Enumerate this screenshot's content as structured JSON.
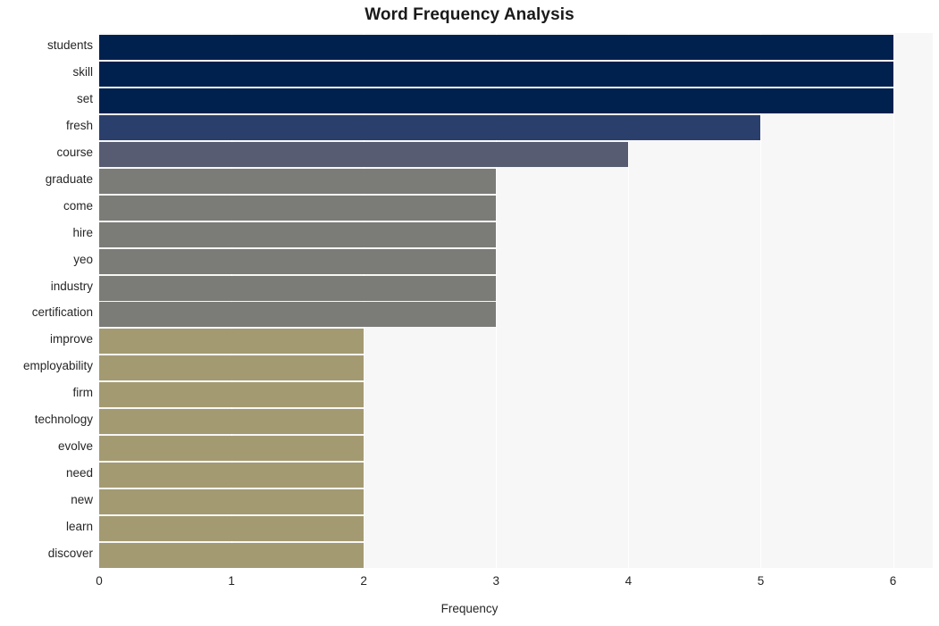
{
  "chart_data": {
    "type": "bar",
    "orientation": "horizontal",
    "title": "Word Frequency Analysis",
    "xlabel": "Frequency",
    "ylabel": "",
    "xlim": [
      0,
      6.3
    ],
    "xticks": [
      0,
      1,
      2,
      3,
      4,
      5,
      6
    ],
    "xtick_labels": [
      "0",
      "1",
      "2",
      "3",
      "4",
      "5",
      "6"
    ],
    "grid": "vertical",
    "legend": "none",
    "categories": [
      "students",
      "skill",
      "set",
      "fresh",
      "course",
      "graduate",
      "come",
      "hire",
      "yeo",
      "industry",
      "certification",
      "improve",
      "employability",
      "firm",
      "technology",
      "evolve",
      "need",
      "new",
      "learn",
      "discover"
    ],
    "values": [
      6,
      6,
      6,
      5,
      4,
      3,
      3,
      3,
      3,
      3,
      3,
      2,
      2,
      2,
      2,
      2,
      2,
      2,
      2,
      2
    ],
    "bar_colors": [
      "#00214e",
      "#00214e",
      "#00214e",
      "#2b3f6c",
      "#575c72",
      "#7b7b78",
      "#7b7b78",
      "#7b7b78",
      "#7b7b78",
      "#7b7b78",
      "#7b7b78",
      "#a49a72",
      "#a49a72",
      "#a49a72",
      "#a49a72",
      "#a49a72",
      "#a49a72",
      "#a49a72",
      "#a49a72",
      "#a49a72"
    ],
    "palette": {
      "high": "#00214e",
      "upper_mid": "#2b3f6c",
      "mid": "#575c72",
      "lower_mid": "#7b7b78",
      "low": "#a49a72"
    },
    "plot_background": "#f7f7f7",
    "gridline_color": "#ffffff",
    "figure_background": "#ffffff",
    "text_color": "#262626"
  }
}
